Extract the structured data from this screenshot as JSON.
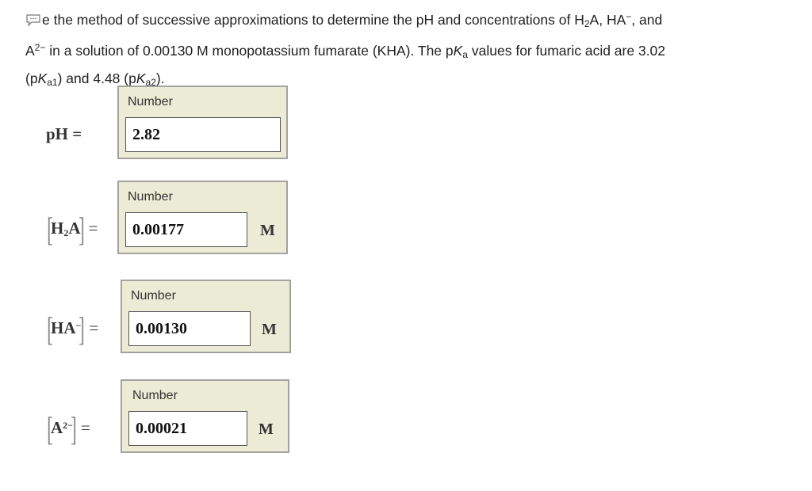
{
  "question": {
    "line1_prefix": "e the method of successive approximations to determine the pH and concentrations of H",
    "line1_sub": "2",
    "line1_mid": "A, HA",
    "line1_sup": "−",
    "line1_suffix": ", and",
    "line2_a": "A",
    "line2_sup": "2−",
    "line2_rest": " in a solution of 0.00130 M monopotassium fumarate (KHA). The p",
    "line2_k": "K",
    "line2_sub": "a",
    "line2_tail": " values for fumaric acid are 3.02",
    "line3_open": "(p",
    "line3_k1": "K",
    "line3_sub1": "a1",
    "line3_mid": ") and 4.48 (p",
    "line3_k2": "K",
    "line3_sub2": "a2",
    "line3_close": ")."
  },
  "answers": [
    {
      "label_text": "pH =",
      "box_title": "Number",
      "value": "2.82",
      "unit": ""
    },
    {
      "label_species": "H",
      "label_sub": "2",
      "label_species2": "A",
      "label_eq": "=",
      "box_title": "Number",
      "value": "0.00177",
      "unit": "M"
    },
    {
      "label_species": "HA",
      "label_sup": "−",
      "label_eq": "=",
      "box_title": "Number",
      "value": "0.00130",
      "unit": "M"
    },
    {
      "label_species": "A",
      "label_sup": "2−",
      "label_eq": "=",
      "box_title": "Number",
      "value": "0.00021",
      "unit": "M"
    }
  ]
}
